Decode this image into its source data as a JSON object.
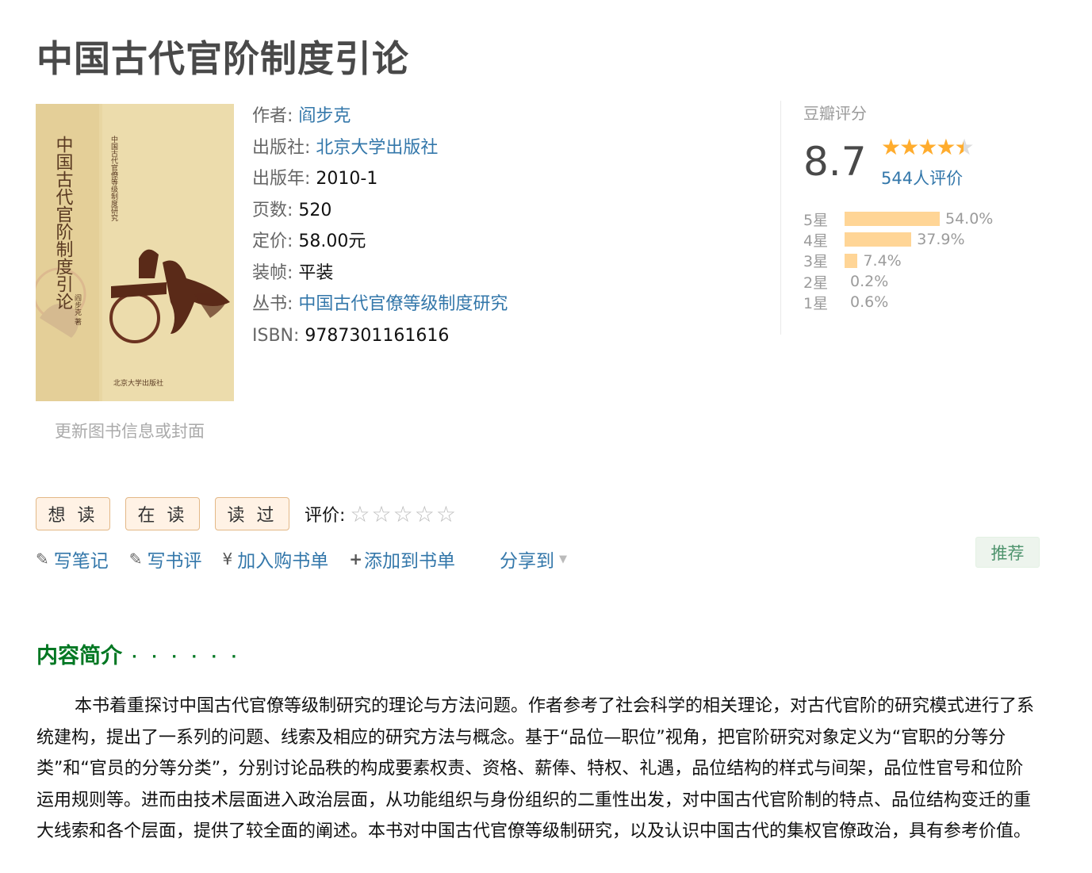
{
  "book": {
    "title": "中国古代官阶制度引论",
    "cover_alt": "中国古代官阶制度引论 封面",
    "update_link": "更新图书信息或封面"
  },
  "info": {
    "author_label": "作者:",
    "author": "阎步克",
    "publisher_label": "出版社:",
    "publisher": "北京大学出版社",
    "year_label": "出版年:",
    "year": "2010-1",
    "pages_label": "页数:",
    "pages": "520",
    "price_label": "定价:",
    "price": "58.00元",
    "binding_label": "装帧:",
    "binding": "平装",
    "series_label": "丛书:",
    "series": "中国古代官僚等级制度研究",
    "isbn_label": "ISBN:",
    "isbn": "9787301161616"
  },
  "rating": {
    "label": "豆瓣评分",
    "score": "8.7",
    "stars_value": 4.5,
    "count": "544人评价",
    "distribution": [
      {
        "label": "5星",
        "pct": "54.0%",
        "value": 54.0
      },
      {
        "label": "4星",
        "pct": "37.9%",
        "value": 37.9
      },
      {
        "label": "3星",
        "pct": "7.4%",
        "value": 7.4
      },
      {
        "label": "2星",
        "pct": "0.2%",
        "value": 0.2
      },
      {
        "label": "1星",
        "pct": "0.6%",
        "value": 0.6
      }
    ],
    "colors": {
      "star": "#ffac2d",
      "bar": "#ffd596"
    }
  },
  "actions": {
    "want": "想 读",
    "reading": "在 读",
    "read": "读 过",
    "rate_label": "评价:",
    "rate_stars": "☆☆☆☆☆"
  },
  "links": {
    "note_icon": "pencil-icon",
    "note": "写笔记",
    "review_icon": "pencil-icon",
    "review": "写书评",
    "cart_icon": "yen-icon",
    "cart": "加入购书单",
    "list_icon": "plus-icon",
    "list": "添加到书单",
    "share": "分享到",
    "recommend": "推荐"
  },
  "intro": {
    "title": "内容简介",
    "dots": "· · · · · ·",
    "text": "本书着重探讨中国古代官僚等级制研究的理论与方法问题。作者参考了社会科学的相关理论，对古代官阶的研究模式进行了系统建构，提出了一系列的问题、线索及相应的研究方法与概念。基于“品位—职位”视角，把官阶研究对象定义为“官职的分等分类”和“官员的分等分类”，分别讨论品秩的构成要素权责、资格、薪俸、特权、礼遇，品位结构的样式与间架，品位性官号和位阶运用规则等。进而由技术层面进入政治层面，从功能组织与身份组织的二重性出发，对中国古代官阶制的特点、品位结构变迁的重大线索和各个层面，提供了较全面的阐述。本书对中国古代官僚等级制研究，以及认识中国古代的集权官僚政治，具有参考价值。"
  }
}
